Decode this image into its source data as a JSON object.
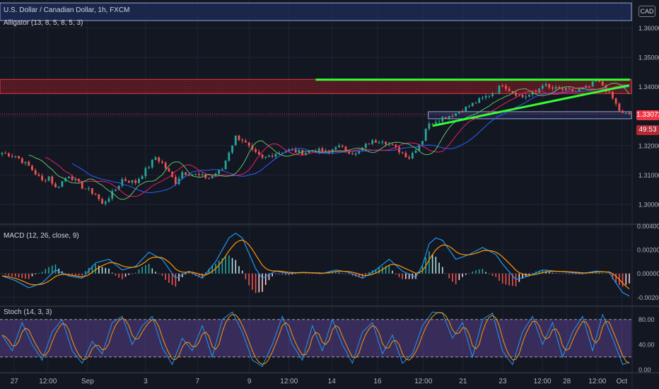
{
  "header": {
    "symbol_title": "U.S. Dollar / Canadian Dollar, 1h, FXCM",
    "alligator_label": "Alligator (13, 8, 5, 8, 5, 3)",
    "macd_label": "MACD (12, 26, close, 9)",
    "stoch_label": "Stoch (14, 3, 3)",
    "currency_badge": "CAD"
  },
  "price_tags": {
    "last_price": "1.33072",
    "countdown": "49:53"
  },
  "colors": {
    "background": "#131722",
    "grid": "#1f2433",
    "up_candle": "#26a69a",
    "down_candle": "#ef5350",
    "trendline": "#33ff33",
    "supply_zone": "#f23645",
    "range_box": "#2962ff",
    "macd_line": "#2196f3",
    "signal_line": "#ff9800",
    "stoch_fill": "#7e57c2",
    "stoch_k": "#2196f3",
    "stoch_d": "#ff9800",
    "last_price_tag": "#f23645"
  },
  "chart_data": [
    {
      "type": "candlestick",
      "title": "U.S. Dollar / Canadian Dollar, 1h, FXCM",
      "x_ticks": [
        "27",
        "12:00",
        "Sep",
        "3",
        "7",
        "9",
        "12:00",
        "14",
        "16",
        "12:00",
        "21",
        "23",
        "12:00",
        "28",
        "12:00",
        "Oct"
      ],
      "y_ticks": [
        "1.36000",
        "1.35000",
        "1.34000",
        "1.33000",
        "1.32000",
        "1.31000",
        "1.30000"
      ],
      "ylim": [
        1.2935,
        1.3695
      ],
      "close_path": [
        [
          0,
          1.3175
        ],
        [
          4,
          1.3165
        ],
        [
          8,
          1.313
        ],
        [
          12,
          1.308
        ],
        [
          14,
          1.3095
        ],
        [
          16,
          1.3055
        ],
        [
          20,
          1.31
        ],
        [
          24,
          1.306
        ],
        [
          28,
          1.3035
        ],
        [
          30,
          1.3
        ],
        [
          34,
          1.305
        ],
        [
          36,
          1.3085
        ],
        [
          40,
          1.3075
        ],
        [
          44,
          1.313
        ],
        [
          46,
          1.316
        ],
        [
          48,
          1.314
        ],
        [
          52,
          1.3075
        ],
        [
          54,
          1.311
        ],
        [
          58,
          1.31
        ],
        [
          62,
          1.309
        ],
        [
          66,
          1.312
        ],
        [
          68,
          1.318
        ],
        [
          70,
          1.323
        ],
        [
          72,
          1.322
        ],
        [
          75,
          1.318
        ],
        [
          78,
          1.3155
        ],
        [
          82,
          1.3175
        ],
        [
          86,
          1.3185
        ],
        [
          90,
          1.3175
        ],
        [
          94,
          1.3185
        ],
        [
          98,
          1.3175
        ],
        [
          100,
          1.32
        ],
        [
          103,
          1.3185
        ],
        [
          106,
          1.317
        ],
        [
          110,
          1.321
        ],
        [
          114,
          1.322
        ],
        [
          118,
          1.319
        ],
        [
          122,
          1.316
        ],
        [
          124,
          1.319
        ],
        [
          126,
          1.322
        ],
        [
          127,
          1.326
        ],
        [
          129,
          1.328
        ],
        [
          132,
          1.3295
        ],
        [
          136,
          1.331
        ],
        [
          140,
          1.3335
        ],
        [
          144,
          1.336
        ],
        [
          148,
          1.3385
        ],
        [
          150,
          1.341
        ],
        [
          152,
          1.339
        ],
        [
          156,
          1.3365
        ],
        [
          160,
          1.338
        ],
        [
          162,
          1.341
        ],
        [
          164,
          1.3395
        ],
        [
          168,
          1.339
        ],
        [
          172,
          1.3385
        ],
        [
          176,
          1.34
        ],
        [
          178,
          1.342
        ],
        [
          180,
          1.3405
        ],
        [
          183,
          1.336
        ],
        [
          185,
          1.332
        ],
        [
          186,
          1.3307
        ]
      ],
      "annotations": {
        "supply_zone": [
          1.3377,
          1.3425
        ],
        "range_box": [
          1.3297,
          1.3308
        ],
        "blue_band": [
          1.3625,
          1.3685
        ],
        "resistance_line": 1.3424,
        "rising_trendline": [
          [
            129,
            1.3267
          ],
          [
            188,
            1.3405
          ]
        ]
      },
      "last_price": 1.33072
    },
    {
      "type": "line",
      "title": "MACD (12, 26, close, 9)",
      "y_ticks": [
        "0.00400",
        "0.00200",
        "0.00000",
        "-0.00200"
      ],
      "ylim": [
        -0.0027,
        0.0041
      ],
      "series": [
        {
          "name": "MACD",
          "points": [
            [
              0,
              -0.0002
            ],
            [
              4,
              -0.0006
            ],
            [
              8,
              -0.0012
            ],
            [
              12,
              -0.0008
            ],
            [
              16,
              0.0003
            ],
            [
              20,
              -0.0002
            ],
            [
              24,
              -0.0004
            ],
            [
              28,
              0.0009
            ],
            [
              32,
              0.0012
            ],
            [
              36,
              0.0003
            ],
            [
              40,
              0.0006
            ],
            [
              44,
              0.0018
            ],
            [
              48,
              0.0012
            ],
            [
              50,
              0.0004
            ],
            [
              52,
              -0.0004
            ],
            [
              56,
              0.0002
            ],
            [
              60,
              -0.0004
            ],
            [
              64,
              0.001
            ],
            [
              68,
              0.003
            ],
            [
              70,
              0.0034
            ],
            [
              72,
              0.003
            ],
            [
              76,
              0.0004
            ],
            [
              78,
              -0.0004
            ],
            [
              82,
              0.0002
            ],
            [
              86,
              0.0
            ],
            [
              90,
              0.0001
            ],
            [
              96,
              0.0
            ],
            [
              100,
              0.0003
            ],
            [
              104,
              0.0001
            ],
            [
              108,
              -0.0004
            ],
            [
              112,
              0.0003
            ],
            [
              116,
              0.0012
            ],
            [
              120,
              0.0002
            ],
            [
              124,
              -0.0003
            ],
            [
              126,
              0.0007
            ],
            [
              128,
              0.0025
            ],
            [
              130,
              0.003
            ],
            [
              132,
              0.0028
            ],
            [
              136,
              0.0012
            ],
            [
              140,
              0.0016
            ],
            [
              144,
              0.0022
            ],
            [
              148,
              0.0016
            ],
            [
              150,
              0.0008
            ],
            [
              154,
              -0.0005
            ],
            [
              158,
              -0.0002
            ],
            [
              162,
              0.0003
            ],
            [
              166,
              0.0002
            ],
            [
              170,
              0.0001
            ],
            [
              174,
              0.0
            ],
            [
              178,
              0.0002
            ],
            [
              182,
              0.0001
            ],
            [
              184,
              -0.0008
            ],
            [
              186,
              -0.0016
            ],
            [
              188,
              -0.0019
            ]
          ]
        }
      ]
    },
    {
      "type": "line",
      "title": "Stoch (14, 3, 3)",
      "y_ticks": [
        "80.00",
        "40.00",
        "0.00"
      ],
      "ylim": [
        -4,
        100
      ],
      "overbought": 80,
      "oversold": 20,
      "series": [
        {
          "name": "Stoch",
          "points": [
            [
              0,
              55
            ],
            [
              3,
              30
            ],
            [
              6,
              75
            ],
            [
              9,
              40
            ],
            [
              12,
              15
            ],
            [
              15,
              60
            ],
            [
              18,
              80
            ],
            [
              21,
              30
            ],
            [
              24,
              10
            ],
            [
              27,
              45
            ],
            [
              30,
              25
            ],
            [
              33,
              75
            ],
            [
              36,
              85
            ],
            [
              39,
              40
            ],
            [
              42,
              70
            ],
            [
              45,
              85
            ],
            [
              48,
              35
            ],
            [
              51,
              8
            ],
            [
              54,
              50
            ],
            [
              57,
              30
            ],
            [
              60,
              70
            ],
            [
              63,
              20
            ],
            [
              66,
              80
            ],
            [
              69,
              92
            ],
            [
              72,
              60
            ],
            [
              75,
              15
            ],
            [
              78,
              5
            ],
            [
              81,
              40
            ],
            [
              84,
              85
            ],
            [
              87,
              40
            ],
            [
              90,
              15
            ],
            [
              93,
              70
            ],
            [
              96,
              30
            ],
            [
              99,
              80
            ],
            [
              102,
              40
            ],
            [
              105,
              10
            ],
            [
              108,
              60
            ],
            [
              111,
              75
            ],
            [
              114,
              25
            ],
            [
              117,
              55
            ],
            [
              120,
              10
            ],
            [
              123,
              25
            ],
            [
              126,
              70
            ],
            [
              129,
              92
            ],
            [
              132,
              90
            ],
            [
              135,
              50
            ],
            [
              138,
              75
            ],
            [
              141,
              20
            ],
            [
              144,
              80
            ],
            [
              147,
              90
            ],
            [
              150,
              30
            ],
            [
              153,
              8
            ],
            [
              156,
              60
            ],
            [
              159,
              85
            ],
            [
              162,
              40
            ],
            [
              165,
              75
            ],
            [
              168,
              20
            ],
            [
              171,
              60
            ],
            [
              174,
              85
            ],
            [
              177,
              30
            ],
            [
              180,
              88
            ],
            [
              183,
              50
            ],
            [
              186,
              8
            ],
            [
              188,
              12
            ]
          ]
        }
      ]
    }
  ]
}
